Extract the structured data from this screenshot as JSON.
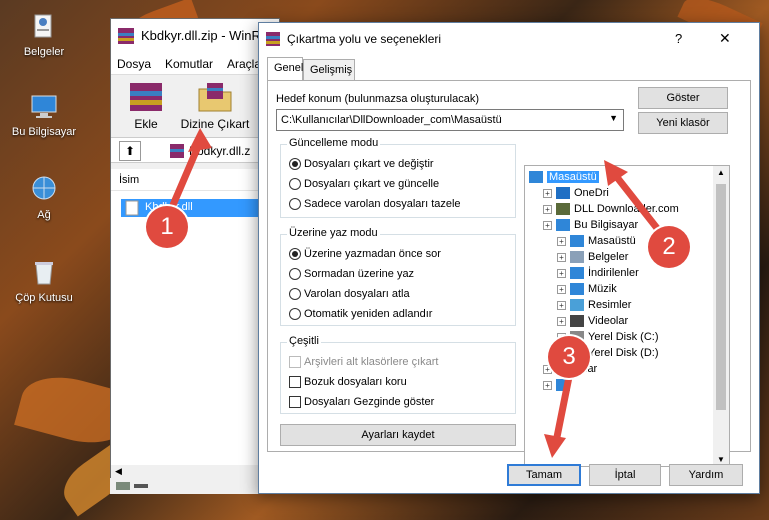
{
  "desktop": {
    "icons": [
      {
        "label": "Belgeler",
        "icon": "folder-documents-icon"
      },
      {
        "label": "Bu Bilgisayar",
        "icon": "computer-icon"
      },
      {
        "label": "Ağ",
        "icon": "network-icon"
      },
      {
        "label": "Çöp Kutusu",
        "icon": "recycle-bin-icon"
      }
    ]
  },
  "winrar": {
    "title": "Kbdkyr.dll.zip - WinR",
    "menu": [
      "Dosya",
      "Komutlar",
      "Araçla"
    ],
    "toolbar": {
      "add": "Ekle",
      "extract_to": "Dizine Çıkart"
    },
    "path": "Kbdkyr.dll.z",
    "column_name": "İsim",
    "file": "Kbdkyr.dll"
  },
  "dialog": {
    "title": "Çıkartma yolu ve seçenekleri",
    "help": "?",
    "close": "✕",
    "tabs": [
      "Genel",
      "Gelişmiş"
    ],
    "dest_label": "Hedef konum (bulunmazsa oluşturulacak)",
    "dest_value": "C:\\Kullanıcılar\\DllDownloader_com\\Masaüstü",
    "show_button": "Göster",
    "new_folder_button": "Yeni klasör",
    "update_mode": {
      "title": "Güncelleme modu",
      "options": [
        "Dosyaları çıkart ve değiştir",
        "Dosyaları çıkart ve güncelle",
        "Sadece varolan dosyaları tazele"
      ],
      "selected": 0
    },
    "overwrite_mode": {
      "title": "Üzerine yaz modu",
      "options": [
        "Üzerine yazmadan önce sor",
        "Sormadan üzerine yaz",
        "Varolan dosyaları atla",
        "Otomatik yeniden adlandır"
      ],
      "selected": 0
    },
    "misc": {
      "title": "Çeşitli",
      "options": [
        "Arşivleri alt klasörlere çıkart",
        "Bozuk dosyaları koru",
        "Dosyaları Gezginde göster"
      ],
      "disabled": [
        true,
        false,
        false
      ]
    },
    "save_settings": "Ayarları kaydet",
    "tree": [
      {
        "label": "Masaüstü",
        "level": 0,
        "selected": true,
        "icon": "desktop-icon"
      },
      {
        "label": "OneDri",
        "level": 1,
        "icon": "onedrive-icon"
      },
      {
        "label": "DLL Downloader.com",
        "level": 1,
        "icon": "user-icon"
      },
      {
        "label": "Bu Bilgisayar",
        "level": 1,
        "icon": "computer-icon"
      },
      {
        "label": "Masaüstü",
        "level": 2,
        "icon": "desktop-icon"
      },
      {
        "label": "Belgeler",
        "level": 2,
        "icon": "documents-icon"
      },
      {
        "label": "İndirilenler",
        "level": 2,
        "icon": "downloads-icon"
      },
      {
        "label": "Müzik",
        "level": 2,
        "icon": "music-icon"
      },
      {
        "label": "Resimler",
        "level": 2,
        "icon": "pictures-icon"
      },
      {
        "label": "Videolar",
        "level": 2,
        "icon": "videos-icon"
      },
      {
        "label": "Yerel Disk (C:)",
        "level": 2,
        "icon": "disk-icon"
      },
      {
        "label": "Yerel Disk (D:)",
        "level": 2,
        "icon": "disk-icon"
      },
      {
        "label": "lıklar",
        "level": 1,
        "icon": "folder-icon"
      },
      {
        "label": "",
        "level": 1,
        "icon": "network-icon"
      }
    ],
    "ok": "Tamam",
    "cancel": "İptal",
    "help_button": "Yardım"
  },
  "callouts": [
    "1",
    "2",
    "3"
  ],
  "colors": {
    "callout": "#e04a3f",
    "selection": "#3399ff",
    "default_button_border": "#2f7bd6"
  }
}
